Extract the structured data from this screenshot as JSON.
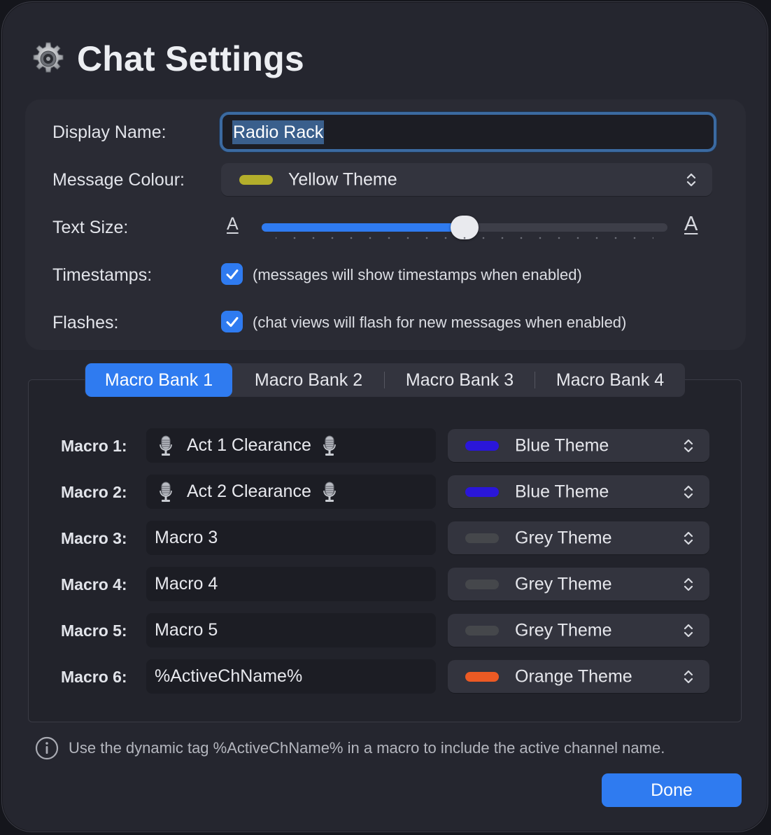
{
  "title": "Chat Settings",
  "display_name": {
    "label": "Display Name:",
    "value": "Radio Rack"
  },
  "message_colour": {
    "label": "Message Colour:",
    "value": "Yellow Theme",
    "swatch": "#b3ae2b"
  },
  "text_size": {
    "label": "Text Size:",
    "small_glyph": "A",
    "large_glyph": "A",
    "level": 0.5,
    "tick_count": 21
  },
  "timestamps": {
    "label": "Timestamps:",
    "checked": true,
    "hint": "(messages will show timestamps when enabled)"
  },
  "flashes": {
    "label": "Flashes:",
    "checked": true,
    "hint": "(chat views will flash for new messages when enabled)"
  },
  "tabs": [
    {
      "label": "Macro Bank 1",
      "active": true
    },
    {
      "label": "Macro Bank 2",
      "active": false
    },
    {
      "label": "Macro Bank 3",
      "active": false
    },
    {
      "label": "Macro Bank 4",
      "active": false
    }
  ],
  "macros": [
    {
      "label": "Macro 1:",
      "value": "Act 1 Clearance",
      "mic": true,
      "theme": "Blue Theme",
      "swatch": "#2a16d9"
    },
    {
      "label": "Macro 2:",
      "value": "Act 2 Clearance",
      "mic": true,
      "theme": "Blue Theme",
      "swatch": "#2a16d9"
    },
    {
      "label": "Macro 3:",
      "value": "Macro 3",
      "mic": false,
      "theme": "Grey Theme",
      "swatch": "#45474b"
    },
    {
      "label": "Macro 4:",
      "value": "Macro 4",
      "mic": false,
      "theme": "Grey Theme",
      "swatch": "#45474b"
    },
    {
      "label": "Macro 5:",
      "value": "Macro 5",
      "mic": false,
      "theme": "Grey Theme",
      "swatch": "#45474b"
    },
    {
      "label": "Macro 6:",
      "value": "%ActiveChName%",
      "mic": false,
      "theme": "Orange Theme",
      "swatch": "#ec5a24"
    }
  ],
  "info": {
    "icon": "info-icon",
    "text": "Use the dynamic tag %ActiveChName% in a macro to include the active channel name."
  },
  "done_label": "Done",
  "accent": "#2f7bf0"
}
